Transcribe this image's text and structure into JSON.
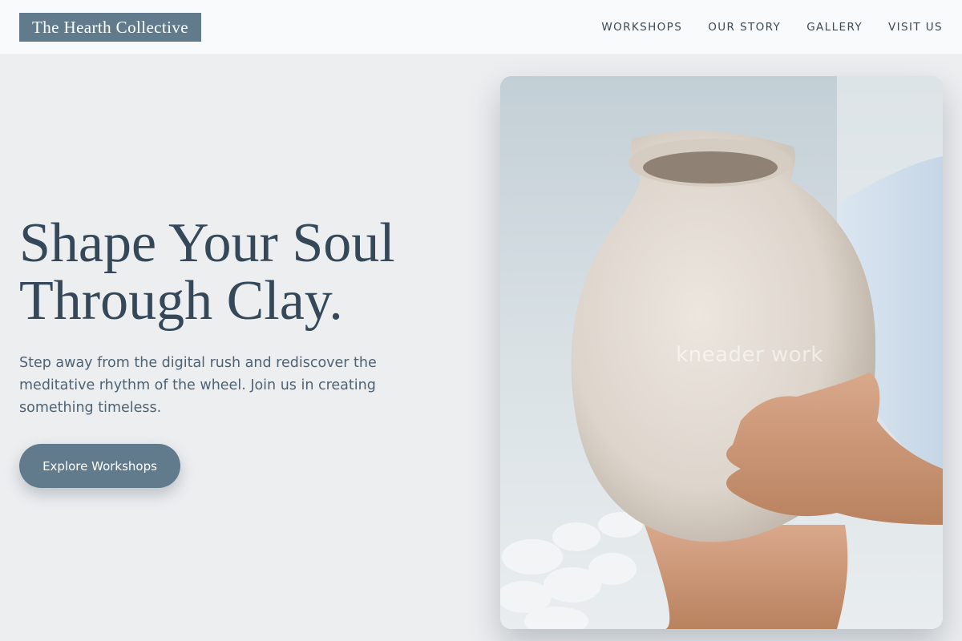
{
  "brand": {
    "name": "The Hearth Collective"
  },
  "nav": {
    "items": [
      {
        "label": "WORKSHOPS"
      },
      {
        "label": "OUR STORY"
      },
      {
        "label": "GALLERY"
      },
      {
        "label": "VISIT US"
      }
    ]
  },
  "hero": {
    "title_line1": "Shape Your Soul",
    "title_line2": "Through Clay.",
    "subtitle": "Step away from the digital rush and rediscover the meditative rhythm of the wheel. Join us in creating something timeless.",
    "cta_label": "Explore Workshops"
  },
  "image": {
    "watermark": "kneader work"
  },
  "colors": {
    "accent": "#617b8c",
    "heading": "#34485a",
    "body_text": "#4f6274",
    "page_bg": "#eceef0"
  }
}
